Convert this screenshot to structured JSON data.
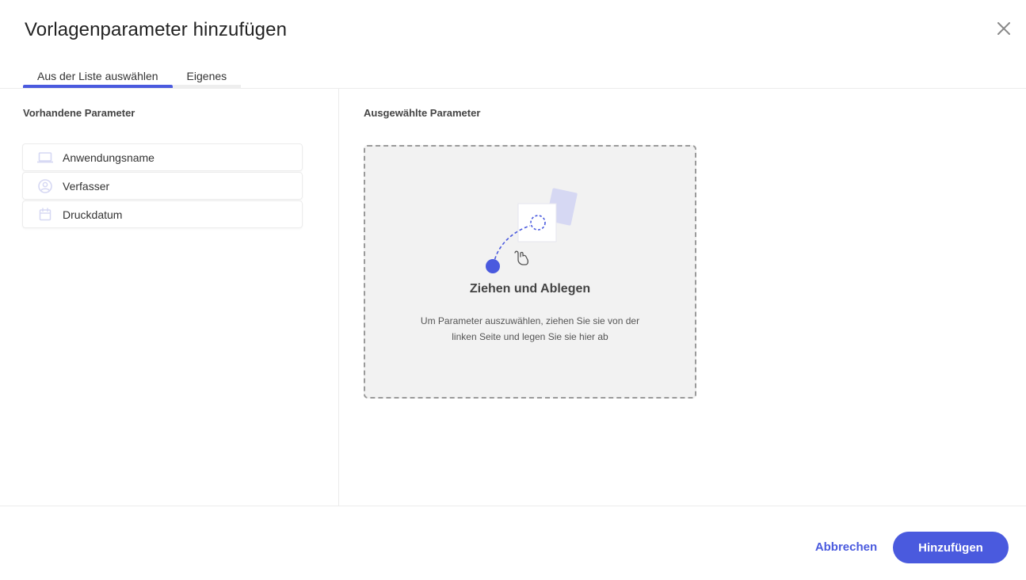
{
  "dialog": {
    "title": "Vorlagenparameter hinzufügen",
    "close_icon": "close-icon"
  },
  "tabs": [
    {
      "label": "Aus der Liste auswählen",
      "active": true
    },
    {
      "label": "Eigenes",
      "active": false
    }
  ],
  "available": {
    "title": "Vorhandene Parameter",
    "items": [
      {
        "label": "Anwendungsname",
        "icon": "laptop-icon"
      },
      {
        "label": "Verfasser",
        "icon": "user-circle-icon"
      },
      {
        "label": "Druckdatum",
        "icon": "calendar-icon"
      }
    ]
  },
  "selected": {
    "title": "Ausgewählte Parameter",
    "drop_title": "Ziehen und Ablegen",
    "drop_desc_line1": "Um Parameter auszuwählen, ziehen Sie sie von der",
    "drop_desc_line2": "linken Seite und legen Sie sie hier ab"
  },
  "footer": {
    "cancel_label": "Abbrechen",
    "add_label": "Hinzufügen"
  },
  "colors": {
    "accent": "#4a5ade",
    "drop_bg": "#f2f2f2",
    "icon_muted": "#d6d8f3"
  }
}
